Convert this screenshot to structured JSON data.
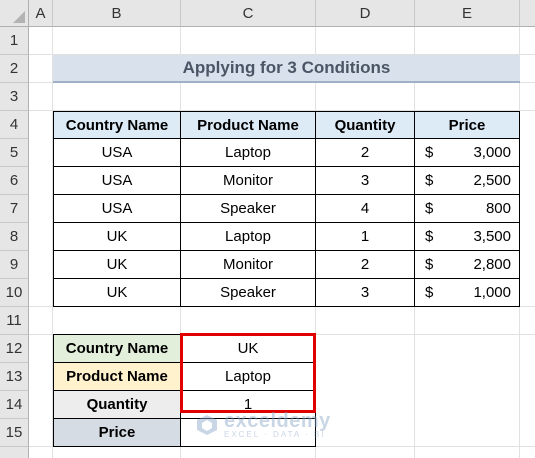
{
  "columns": [
    "A",
    "B",
    "C",
    "D",
    "E"
  ],
  "rows": [
    "1",
    "2",
    "3",
    "4",
    "5",
    "6",
    "7",
    "8",
    "9",
    "10",
    "11",
    "12",
    "13",
    "14",
    "15"
  ],
  "title": "Applying for 3 Conditions",
  "table": {
    "headers": [
      "Country Name",
      "Product Name",
      "Quantity",
      "Price"
    ],
    "currency": "$",
    "rows": [
      [
        "USA",
        "Laptop",
        "2",
        "3,000"
      ],
      [
        "USA",
        "Monitor",
        "3",
        "2,500"
      ],
      [
        "USA",
        "Speaker",
        "4",
        "800"
      ],
      [
        "UK",
        "Laptop",
        "1",
        "3,500"
      ],
      [
        "UK",
        "Monitor",
        "2",
        "2,800"
      ],
      [
        "UK",
        "Speaker",
        "3",
        "1,000"
      ]
    ]
  },
  "criteria": {
    "labels": [
      "Country Name",
      "Product Name",
      "Quantity",
      "Price"
    ],
    "values": [
      "UK",
      "Laptop",
      "1",
      ""
    ]
  },
  "watermark": {
    "name": "exceldemy",
    "sub": "EXCEL · DATA · BI"
  },
  "colors": {
    "highlight": "#e00000",
    "header_fill": "#ddebf7"
  }
}
